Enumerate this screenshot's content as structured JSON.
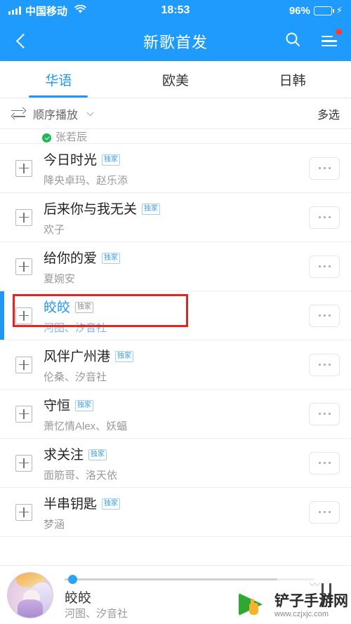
{
  "status_bar": {
    "carrier": "中国移动",
    "time": "18:53",
    "battery_percent": "96%",
    "signal_icon": "signal-bars-icon",
    "wifi_icon": "wifi-icon",
    "battery_icon": "battery-icon",
    "charging_icon": "bolt-icon"
  },
  "header": {
    "title": "新歌首发",
    "back_icon": "chevron-left-icon",
    "search_icon": "search-icon",
    "menu_icon": "hamburger-menu-icon",
    "badge_icon": "red-dot-badge",
    "background_color": "#1E9BFC"
  },
  "tabs": [
    {
      "label": "华语",
      "active": true
    },
    {
      "label": "欧美",
      "active": false
    },
    {
      "label": "日韩",
      "active": false
    }
  ],
  "toolbar": {
    "sort_icon": "sequence-play-icon",
    "sort_label": "顺序播放",
    "chevron_icon": "chevron-down-icon",
    "multi_select_label": "多选"
  },
  "partial_row": {
    "verified_icon": "verified-check-icon",
    "artist": "张若辰"
  },
  "songs": [
    {
      "title": "今日时光",
      "badge": "独家",
      "artist": "降央卓玛、赵乐添",
      "active": false,
      "add_icon": "plus-square-icon",
      "more_icon": "ellipsis-icon"
    },
    {
      "title": "后来你与我无关",
      "badge": "独家",
      "artist": "欢子",
      "active": false,
      "add_icon": "plus-square-icon",
      "more_icon": "ellipsis-icon"
    },
    {
      "title": "给你的爱",
      "badge": "独家",
      "artist": "夏婉安",
      "active": false,
      "add_icon": "plus-square-icon",
      "more_icon": "ellipsis-icon"
    },
    {
      "title": "皎皎",
      "badge": "独家",
      "artist": "河图、汐音社",
      "active": true,
      "annotated": true,
      "add_icon": "plus-square-icon",
      "more_icon": "ellipsis-icon"
    },
    {
      "title": "风伴广州港",
      "badge": "独家",
      "artist": "伦桑、汐音社",
      "active": false,
      "add_icon": "plus-square-icon",
      "more_icon": "ellipsis-icon"
    },
    {
      "title": "守恒",
      "badge": "独家",
      "artist": "萧忆情Alex、妖蝠",
      "active": false,
      "add_icon": "plus-square-icon",
      "more_icon": "ellipsis-icon"
    },
    {
      "title": "求关注",
      "badge": "独家",
      "artist": "面筋哥、洛天依",
      "active": false,
      "add_icon": "plus-square-icon",
      "more_icon": "ellipsis-icon"
    },
    {
      "title": "半串钥匙",
      "badge": "独家",
      "artist": "梦涵",
      "active": false,
      "add_icon": "plus-square-icon",
      "more_icon": "ellipsis-icon"
    }
  ],
  "player": {
    "album_art_icon": "album-cover-art",
    "title": "皎皎",
    "artist": "河图、汐音社",
    "pause_icon": "pause-icon",
    "progress_percent": 2,
    "buffer_percent": 85
  },
  "watermark": {
    "site_name": "铲子手游网",
    "url": "www.czjxjc.com",
    "logo_icon": "green-cursor-logo"
  },
  "theme": {
    "accent": "#2196F3",
    "header_blue": "#1E9BFC",
    "annotation_red": "#E52420",
    "badge_blue": "#3A9BE8"
  }
}
